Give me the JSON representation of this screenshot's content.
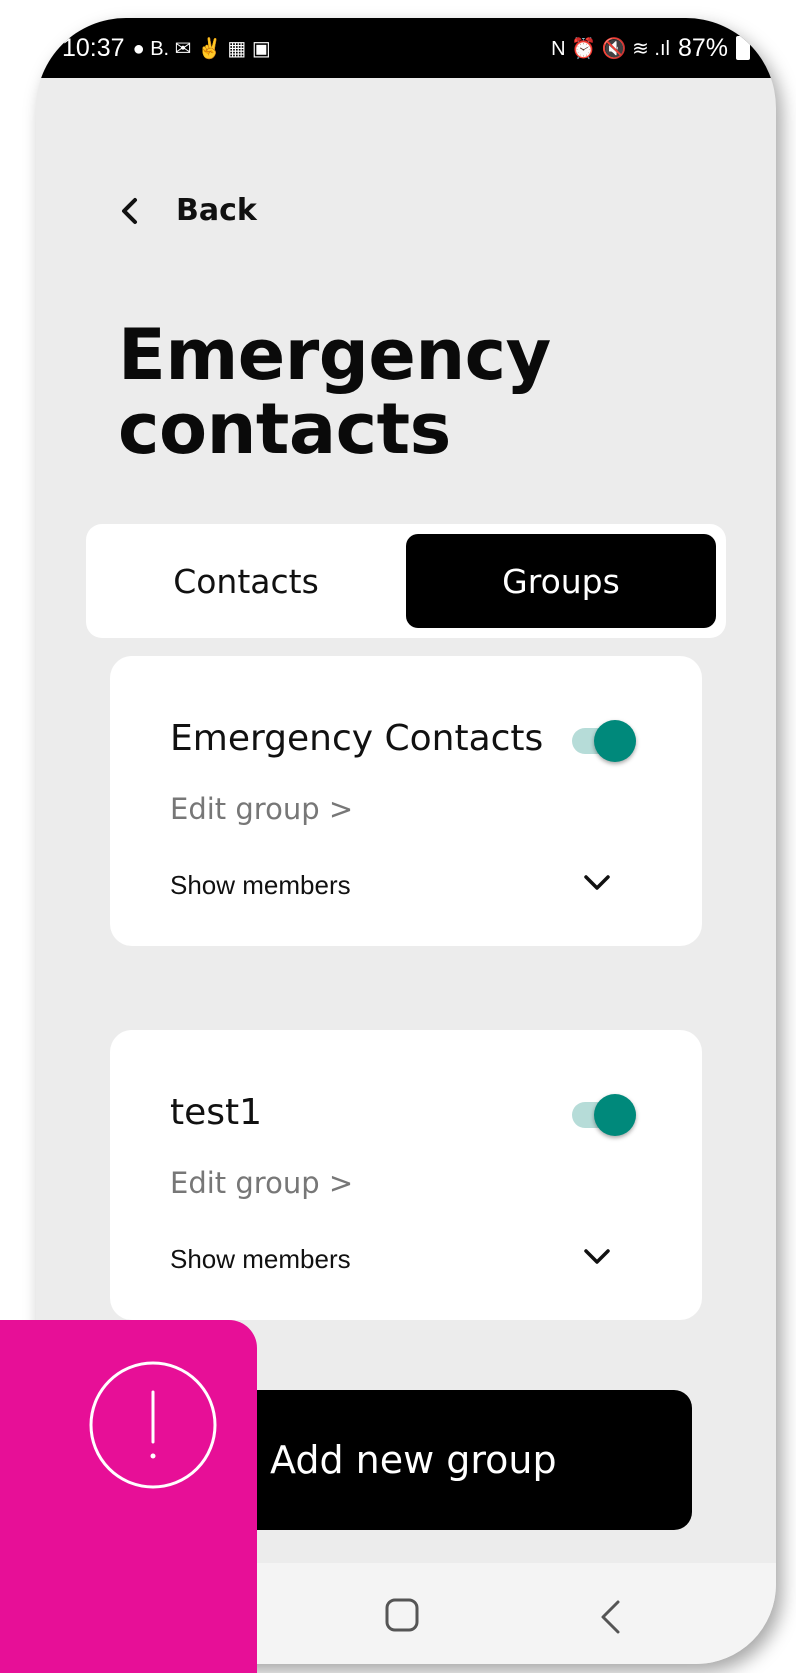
{
  "status_bar": {
    "time": "10:37",
    "left_glyphs": "● B. ✉ ✌ ▦ ▣",
    "right_glyphs": "N ⏰ 🔇 ≋ .ıl",
    "battery": "87%"
  },
  "header": {
    "back_label": "Back",
    "title": "Emergency contacts"
  },
  "tabs": [
    {
      "label": "Contacts",
      "selected": false
    },
    {
      "label": "Groups",
      "selected": true
    }
  ],
  "groups": [
    {
      "name": "Emergency Contacts",
      "enabled": true,
      "edit_label": "Edit group >",
      "members_label": "Show members"
    },
    {
      "name": "test1",
      "enabled": true,
      "edit_label": "Edit group >",
      "members_label": "Show members"
    }
  ],
  "add_group_label": "Add new group",
  "colors": {
    "accent_pink": "#e70f97",
    "toggle_on": "#00897b",
    "primary_black": "#000000"
  },
  "icons": {
    "back": "chevron-left-icon",
    "expand": "chevron-down-icon",
    "alert": "exclamation-circle-icon",
    "nav_home": "home-square-icon",
    "nav_back": "nav-back-icon"
  }
}
